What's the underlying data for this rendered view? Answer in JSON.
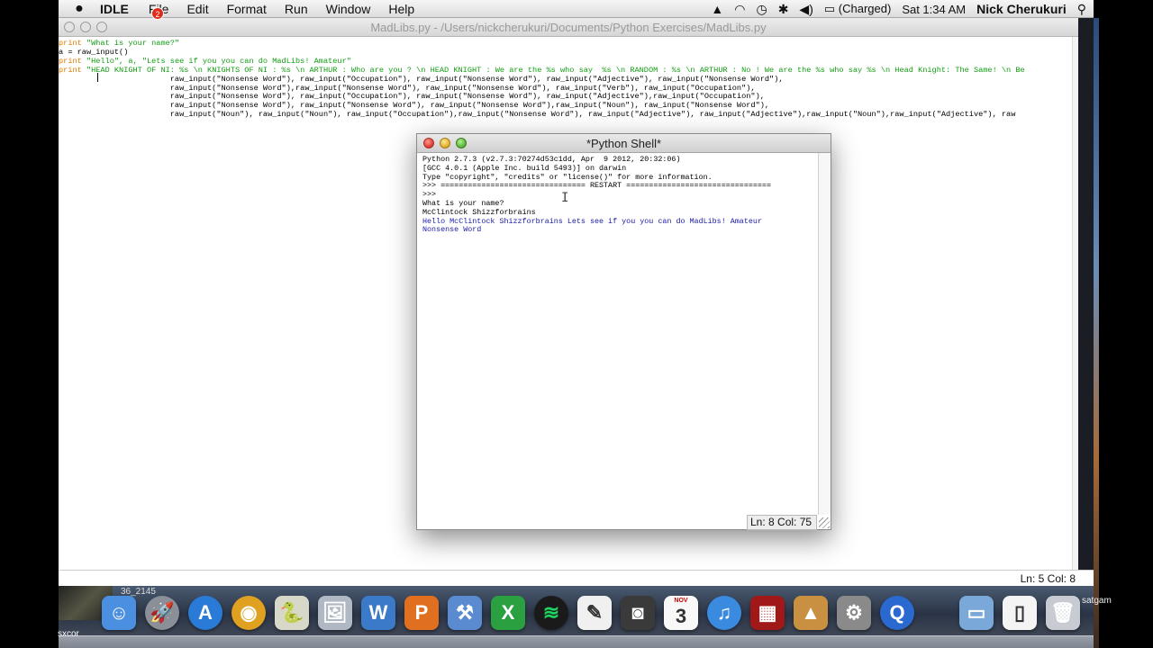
{
  "menubar": {
    "app": "IDLE",
    "menus": [
      "File",
      "Edit",
      "Format",
      "Run",
      "Window",
      "Help"
    ],
    "battery": "(Charged)",
    "datetime": "Sat 1:34 AM",
    "user": "Nick Cherukuri"
  },
  "editor": {
    "title": "MadLibs.py - /Users/nickcherukuri/Documents/Python Exercises/MadLibs.py",
    "lines": [
      {
        "kw": "print ",
        "str": "\"What is your name?\"",
        "rest": ""
      },
      {
        "kw": "",
        "str": "",
        "rest": "a = raw_input()"
      },
      {
        "kw": "print ",
        "str": "\"Hello\", a, \"Lets see if you you can do MadLibs! Amateur\"",
        "rest": ""
      },
      {
        "kw": "print ",
        "str": "\"HEAD KNIGHT OF NI: %s \\n KNIGHTS OF NI : %s \\n ARTHUR : Who are you ? \\n HEAD KNIGHT : We are the %s who say  %s \\n RANDOM : %s \\n ARTHUR : No ! We are the %s who say %s \\n Head Knight: The Same! \\n Be",
        "rest": ""
      },
      {
        "kw": "",
        "str": "",
        "rest": "                        raw_input(\"Nonsense Word\"), raw_input(\"Occupation\"), raw_input(\"Nonsense Word\"), raw_input(\"Adjective\"), raw_input(\"Nonsense Word\"),"
      },
      {
        "kw": "",
        "str": "",
        "rest": "                        raw_input(\"Nonsense Word\"),raw_input(\"Nonsense Word\"), raw_input(\"Nonsense Word\"), raw_input(\"Verb\"), raw_input(\"Occupation\"),"
      },
      {
        "kw": "",
        "str": "",
        "rest": "                        raw_input(\"Nonsense Word\"), raw_input(\"Occupation\"), raw_input(\"Nonsense Word\"), raw_input(\"Adjective\"),raw_input(\"Occupation\"),"
      },
      {
        "kw": "",
        "str": "",
        "rest": "                        raw_input(\"Nonsense Word\"), raw_input(\"Nonsense Word\"), raw_input(\"Nonsense Word\"),raw_input(\"Noun\"), raw_input(\"Nonsense Word\"),"
      },
      {
        "kw": "",
        "str": "",
        "rest": "                        raw_input(\"Noun\"), raw_input(\"Noun\"), raw_input(\"Occupation\"),raw_input(\"Nonsense Word\"), raw_input(\"Adjective\"), raw_input(\"Adjective\"),raw_input(\"Noun\"),raw_input(\"Adjective\"), raw"
      }
    ],
    "status": "Ln: 5 Col: 8"
  },
  "shell": {
    "title": "*Python Shell*",
    "lines": [
      {
        "text": "Python 2.7.3 (v2.7.3:70274d53c1dd, Apr  9 2012, 20:32:06)",
        "type": "normal"
      },
      {
        "text": "[GCC 4.0.1 (Apple Inc. build 5493)] on darwin",
        "type": "normal"
      },
      {
        "text": "Type \"copyright\", \"credits\" or \"license()\" for more information.",
        "type": "normal"
      },
      {
        "text": ">>> ================================ RESTART ================================",
        "type": "normal"
      },
      {
        "text": ">>> ",
        "type": "normal"
      },
      {
        "text": "What is your name?",
        "type": "normal"
      },
      {
        "text": "McClintock Shizzforbrains",
        "type": "normal"
      },
      {
        "text": "Hello McClintock Shizzforbrains Lets see if you you can do MadLibs! Amateur",
        "type": "out"
      },
      {
        "text": "Nonsense Word",
        "type": "out"
      }
    ],
    "status": "Ln: 8 Col: 75"
  },
  "dock": {
    "badge": "2",
    "calendar_day": "3",
    "calendar_month": "NOV",
    "thumb_label": "36_2145",
    "desk_label": "sxcor",
    "tray_label": "satgam",
    "items": [
      {
        "name": "finder-icon",
        "glyph": "☺",
        "color": "#4a8fe0"
      },
      {
        "name": "launchpad-icon",
        "glyph": "🚀",
        "color": "#8a8f98"
      },
      {
        "name": "app-store-icon",
        "glyph": "A",
        "color": "#2a7ad8"
      },
      {
        "name": "chrome-icon",
        "glyph": "◉",
        "color": "#e0a020"
      },
      {
        "name": "python-launcher-icon",
        "glyph": "🐍",
        "color": "#d8d8c8"
      },
      {
        "name": "preview-icon",
        "glyph": "🖼",
        "color": "#b0b8c4"
      },
      {
        "name": "word-icon",
        "glyph": "W",
        "color": "#3a7ac8"
      },
      {
        "name": "powerpoint-icon",
        "glyph": "P",
        "color": "#e07020"
      },
      {
        "name": "xcode-icon",
        "glyph": "⚒",
        "color": "#5a8ad0"
      },
      {
        "name": "excel-icon",
        "glyph": "X",
        "color": "#2aa040"
      },
      {
        "name": "spotify-icon",
        "glyph": "≋",
        "color": "#1a1a1a"
      },
      {
        "name": "textedit-icon",
        "glyph": "✎",
        "color": "#f0f0f0"
      },
      {
        "name": "facetime-icon",
        "glyph": "◙",
        "color": "#3a3a3a"
      },
      {
        "name": "calendar-icon",
        "glyph": "",
        "color": "#f8f8f8"
      },
      {
        "name": "itunes-icon",
        "glyph": "♫",
        "color": "#3a8ae0"
      },
      {
        "name": "photo-booth-icon",
        "glyph": "▦",
        "color": "#a01818"
      },
      {
        "name": "iphoto-icon",
        "glyph": "▲",
        "color": "#c89040"
      },
      {
        "name": "system-preferences-icon",
        "glyph": "⚙",
        "color": "#8a8a8a"
      },
      {
        "name": "quicktime-icon",
        "glyph": "Q",
        "color": "#2a6ad0"
      },
      {
        "name": "downloads-folder-icon",
        "glyph": "▭",
        "color": "#7aa8d8"
      },
      {
        "name": "documents-icon",
        "glyph": "▯",
        "color": "#f4f4f4"
      },
      {
        "name": "trash-icon",
        "glyph": "🗑",
        "color": "#c8ccd2"
      }
    ]
  }
}
